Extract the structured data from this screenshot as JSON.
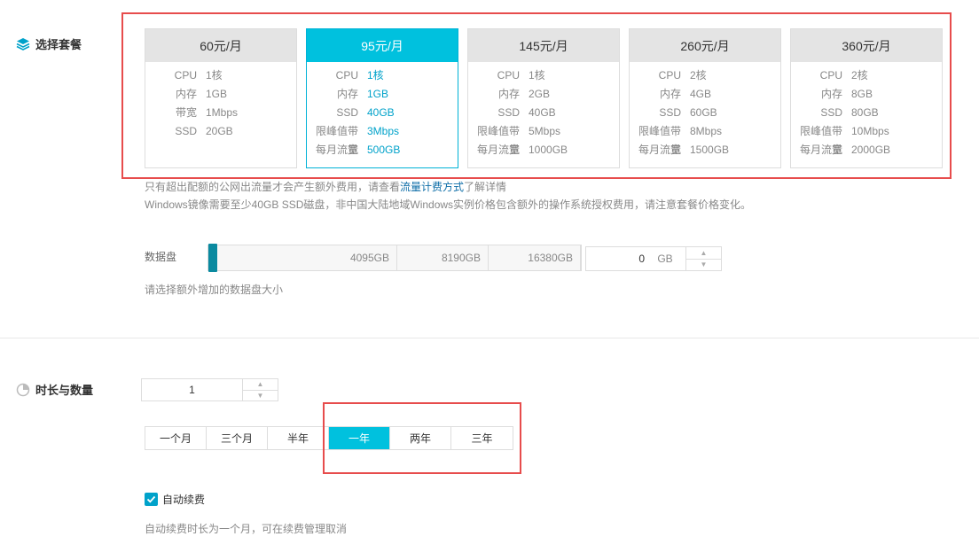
{
  "plan_section": {
    "title": "选择套餐"
  },
  "plans": [
    {
      "price": "60元/月",
      "selected": false,
      "rows": [
        {
          "k": "CPU",
          "v": "1核"
        },
        {
          "k": "内存",
          "v": "1GB"
        },
        {
          "k": "带宽",
          "v": "1Mbps"
        },
        {
          "k": "SSD",
          "v": "20GB"
        }
      ]
    },
    {
      "price": "95元/月",
      "selected": true,
      "rows": [
        {
          "k": "CPU",
          "v": "1核"
        },
        {
          "k": "内存",
          "v": "1GB"
        },
        {
          "k": "SSD",
          "v": "40GB"
        },
        {
          "k": "限峰值带宽",
          "v": "3Mbps"
        },
        {
          "k": "每月流量",
          "v": "500GB"
        }
      ]
    },
    {
      "price": "145元/月",
      "selected": false,
      "rows": [
        {
          "k": "CPU",
          "v": "1核"
        },
        {
          "k": "内存",
          "v": "2GB"
        },
        {
          "k": "SSD",
          "v": "40GB"
        },
        {
          "k": "限峰值带宽",
          "v": "5Mbps"
        },
        {
          "k": "每月流量",
          "v": "1000GB"
        }
      ]
    },
    {
      "price": "260元/月",
      "selected": false,
      "rows": [
        {
          "k": "CPU",
          "v": "2核"
        },
        {
          "k": "内存",
          "v": "4GB"
        },
        {
          "k": "SSD",
          "v": "60GB"
        },
        {
          "k": "限峰值带宽",
          "v": "8Mbps"
        },
        {
          "k": "每月流量",
          "v": "1500GB"
        }
      ]
    },
    {
      "price": "360元/月",
      "selected": false,
      "rows": [
        {
          "k": "CPU",
          "v": "2核"
        },
        {
          "k": "内存",
          "v": "8GB"
        },
        {
          "k": "SSD",
          "v": "80GB"
        },
        {
          "k": "限峰值带宽",
          "v": "10Mbps"
        },
        {
          "k": "每月流量",
          "v": "2000GB"
        }
      ]
    }
  ],
  "notes": {
    "line1_prefix": "只有超出配额的公网出流量才会产生额外费用，请查看",
    "line1_link": "流量计费方式",
    "line1_suffix": "了解详情",
    "line2": "Windows镜像需要至少40GB SSD磁盘，非中国大陆地域Windows实例价格包含额外的操作系统授权费用，请注意套餐价格变化。"
  },
  "data_disk": {
    "label": "数据盘",
    "ticks": [
      "4095GB",
      "8190GB",
      "16380GB"
    ],
    "value": "0",
    "unit": "GB",
    "hint": "请选择额外增加的数据盘大小",
    "up_arrow": "▲",
    "down_arrow": "▼"
  },
  "duration_section": {
    "title": "时长与数量"
  },
  "quantity": {
    "value": "1",
    "up_arrow": "▲",
    "down_arrow": "▼"
  },
  "durations": [
    {
      "label": "一个月",
      "active": false
    },
    {
      "label": "三个月",
      "active": false
    },
    {
      "label": "半年",
      "active": false
    },
    {
      "label": "一年",
      "active": true
    },
    {
      "label": "两年",
      "active": false
    },
    {
      "label": "三年",
      "active": false
    }
  ],
  "auto_renew": {
    "label": "自动续费",
    "checked": true,
    "hint": "自动续费时长为一个月，可在续费管理取消"
  },
  "colors": {
    "accent": "#00c1de",
    "highlight": "#e74c4c",
    "link": "#0f6ea8"
  }
}
